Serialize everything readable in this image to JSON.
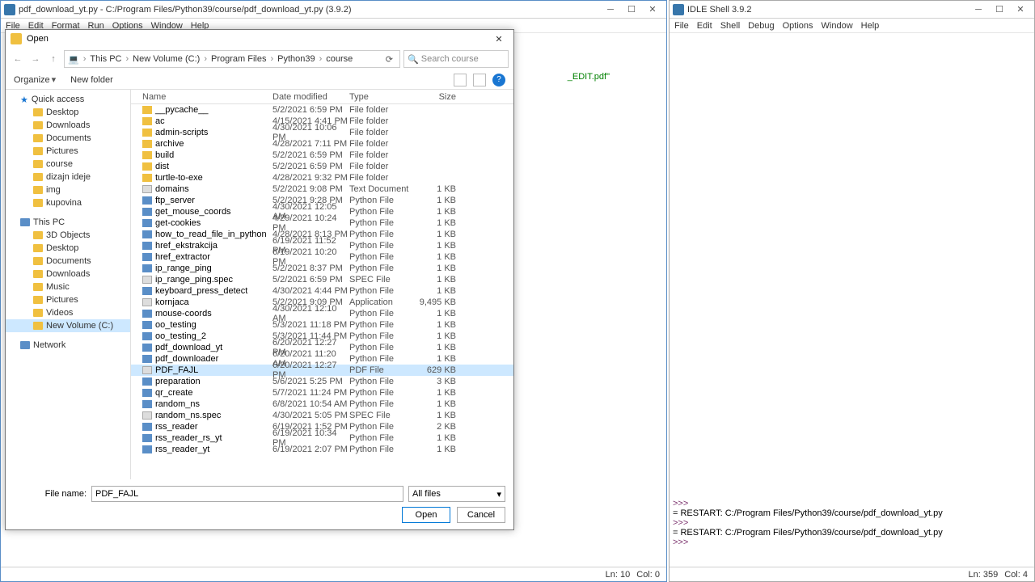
{
  "editor_window": {
    "title": "pdf_download_yt.py - C:/Program Files/Python39/course/pdf_download_yt.py (3.9.2)",
    "menu": [
      "File",
      "Edit",
      "Format",
      "Run",
      "Options",
      "Window",
      "Help"
    ],
    "visible_code_fragment": "_EDIT.pdf\"",
    "status": {
      "ln": "Ln: 10",
      "col": "Col: 0"
    }
  },
  "shell_window": {
    "title": "IDLE Shell 3.9.2",
    "menu": [
      "File",
      "Edit",
      "Shell",
      "Debug",
      "Options",
      "Window",
      "Help"
    ],
    "lines": [
      ">>> ",
      "= RESTART: C:/Program Files/Python39/course/pdf_download_yt.py",
      ">>> ",
      "= RESTART: C:/Program Files/Python39/course/pdf_download_yt.py",
      ">>> "
    ],
    "status": {
      "ln": "Ln: 359",
      "col": "Col: 4"
    }
  },
  "dialog": {
    "title": "Open",
    "breadcrumbs": [
      "This PC",
      "New Volume (C:)",
      "Program Files",
      "Python39",
      "course"
    ],
    "search_placeholder": "Search course",
    "organize": "Organize",
    "new_folder": "New folder",
    "sidebar": {
      "quick": {
        "label": "Quick access",
        "items": [
          "Desktop",
          "Downloads",
          "Documents",
          "Pictures",
          "course",
          "dizajn ideje",
          "img",
          "kupovina"
        ]
      },
      "thispc": {
        "label": "This PC",
        "items": [
          "3D Objects",
          "Desktop",
          "Documents",
          "Downloads",
          "Music",
          "Pictures",
          "Videos",
          "New Volume (C:)"
        ]
      },
      "network": "Network"
    },
    "columns": [
      "Name",
      "Date modified",
      "Type",
      "Size"
    ],
    "files": [
      {
        "n": "__pycache__",
        "d": "5/2/2021 6:59 PM",
        "t": "File folder",
        "s": "",
        "ic": "fic"
      },
      {
        "n": "ac",
        "d": "4/15/2021 4:41 PM",
        "t": "File folder",
        "s": "",
        "ic": "fic"
      },
      {
        "n": "admin-scripts",
        "d": "4/30/2021 10:06 PM",
        "t": "File folder",
        "s": "",
        "ic": "fic"
      },
      {
        "n": "archive",
        "d": "4/28/2021 7:11 PM",
        "t": "File folder",
        "s": "",
        "ic": "fic"
      },
      {
        "n": "build",
        "d": "5/2/2021 6:59 PM",
        "t": "File folder",
        "s": "",
        "ic": "fic"
      },
      {
        "n": "dist",
        "d": "5/2/2021 6:59 PM",
        "t": "File folder",
        "s": "",
        "ic": "fic"
      },
      {
        "n": "turtle-to-exe",
        "d": "4/28/2021 9:32 PM",
        "t": "File folder",
        "s": "",
        "ic": "fic"
      },
      {
        "n": "domains",
        "d": "5/2/2021 9:08 PM",
        "t": "Text Document",
        "s": "1 KB",
        "ic": "txtic"
      },
      {
        "n": "ftp_server",
        "d": "5/2/2021 9:28 PM",
        "t": "Python File",
        "s": "1 KB",
        "ic": "pyic"
      },
      {
        "n": "get_mouse_coords",
        "d": "4/30/2021 12:05 AM",
        "t": "Python File",
        "s": "1 KB",
        "ic": "pyic"
      },
      {
        "n": "get-cookies",
        "d": "4/29/2021 10:24 PM",
        "t": "Python File",
        "s": "1 KB",
        "ic": "pyic"
      },
      {
        "n": "how_to_read_file_in_python",
        "d": "4/28/2021 8:13 PM",
        "t": "Python File",
        "s": "1 KB",
        "ic": "pyic"
      },
      {
        "n": "href_ekstrakcija",
        "d": "6/19/2021 11:52 PM",
        "t": "Python File",
        "s": "1 KB",
        "ic": "pyic"
      },
      {
        "n": "href_extractor",
        "d": "6/19/2021 10:20 PM",
        "t": "Python File",
        "s": "1 KB",
        "ic": "pyic"
      },
      {
        "n": "ip_range_ping",
        "d": "5/2/2021 8:37 PM",
        "t": "Python File",
        "s": "1 KB",
        "ic": "pyic"
      },
      {
        "n": "ip_range_ping.spec",
        "d": "5/2/2021 6:59 PM",
        "t": "SPEC File",
        "s": "1 KB",
        "ic": "txtic"
      },
      {
        "n": "keyboard_press_detect",
        "d": "4/30/2021 4:44 PM",
        "t": "Python File",
        "s": "1 KB",
        "ic": "pyic"
      },
      {
        "n": "kornjaca",
        "d": "5/2/2021 9:09 PM",
        "t": "Application",
        "s": "9,495 KB",
        "ic": "txtic"
      },
      {
        "n": "mouse-coords",
        "d": "4/30/2021 12:10 AM",
        "t": "Python File",
        "s": "1 KB",
        "ic": "pyic"
      },
      {
        "n": "oo_testing",
        "d": "5/3/2021 11:18 PM",
        "t": "Python File",
        "s": "1 KB",
        "ic": "pyic"
      },
      {
        "n": "oo_testing_2",
        "d": "5/3/2021 11:44 PM",
        "t": "Python File",
        "s": "1 KB",
        "ic": "pyic"
      },
      {
        "n": "pdf_download_yt",
        "d": "6/20/2021 12:27 PM",
        "t": "Python File",
        "s": "1 KB",
        "ic": "pyic"
      },
      {
        "n": "pdf_downloader",
        "d": "6/20/2021 11:20 AM",
        "t": "Python File",
        "s": "1 KB",
        "ic": "pyic"
      },
      {
        "n": "PDF_FAJL",
        "d": "6/20/2021 12:27 PM",
        "t": "PDF File",
        "s": "629 KB",
        "ic": "txtic",
        "sel": true
      },
      {
        "n": "preparation",
        "d": "5/6/2021 5:25 PM",
        "t": "Python File",
        "s": "3 KB",
        "ic": "pyic"
      },
      {
        "n": "qr_create",
        "d": "5/7/2021 11:24 PM",
        "t": "Python File",
        "s": "1 KB",
        "ic": "pyic"
      },
      {
        "n": "random_ns",
        "d": "6/8/2021 10:54 AM",
        "t": "Python File",
        "s": "1 KB",
        "ic": "pyic"
      },
      {
        "n": "random_ns.spec",
        "d": "4/30/2021 5:05 PM",
        "t": "SPEC File",
        "s": "1 KB",
        "ic": "txtic"
      },
      {
        "n": "rss_reader",
        "d": "6/19/2021 1:52 PM",
        "t": "Python File",
        "s": "2 KB",
        "ic": "pyic"
      },
      {
        "n": "rss_reader_rs_yt",
        "d": "6/19/2021 10:34 PM",
        "t": "Python File",
        "s": "1 KB",
        "ic": "pyic"
      },
      {
        "n": "rss_reader_yt",
        "d": "6/19/2021 2:07 PM",
        "t": "Python File",
        "s": "1 KB",
        "ic": "pyic"
      }
    ],
    "filename_label": "File name:",
    "filename_value": "PDF_FAJL",
    "filetype": "All files",
    "open_btn": "Open",
    "cancel_btn": "Cancel"
  }
}
